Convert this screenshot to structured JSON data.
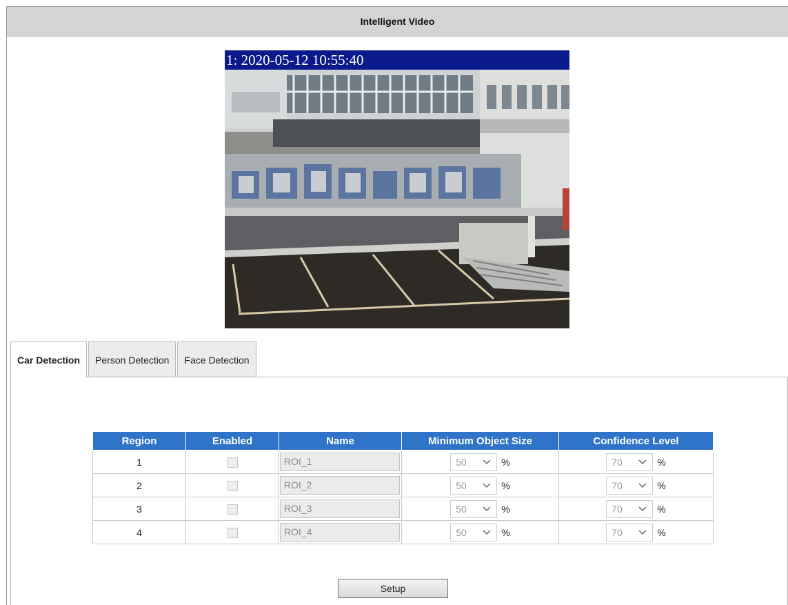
{
  "page": {
    "title": "Intelligent Video"
  },
  "video": {
    "timestamp": "1: 2020-05-12 10:55:40"
  },
  "tabs": [
    {
      "label": "Car Detection",
      "active": true
    },
    {
      "label": "Person Detection",
      "active": false
    },
    {
      "label": "Face Detection",
      "active": false
    }
  ],
  "table": {
    "headers": {
      "region": "Region",
      "enabled": "Enabled",
      "name": "Name",
      "min_size": "Minimum Object Size",
      "confidence": "Confidence Level"
    },
    "rows": [
      {
        "region": "1",
        "enabled": false,
        "name": "ROI_1",
        "min_size": "50",
        "min_unit": "%",
        "confidence": "70",
        "conf_unit": "%"
      },
      {
        "region": "2",
        "enabled": false,
        "name": "ROI_2",
        "min_size": "50",
        "min_unit": "%",
        "confidence": "70",
        "conf_unit": "%"
      },
      {
        "region": "3",
        "enabled": false,
        "name": "ROI_3",
        "min_size": "50",
        "min_unit": "%",
        "confidence": "70",
        "conf_unit": "%"
      },
      {
        "region": "4",
        "enabled": false,
        "name": "ROI_4",
        "min_size": "50",
        "min_unit": "%",
        "confidence": "70",
        "conf_unit": "%"
      }
    ]
  },
  "buttons": {
    "setup": "Setup"
  },
  "colors": {
    "header_blue": "#2f74c9",
    "title_bar": "#d4d4d4",
    "osd_bar": "#0a1a8c"
  }
}
